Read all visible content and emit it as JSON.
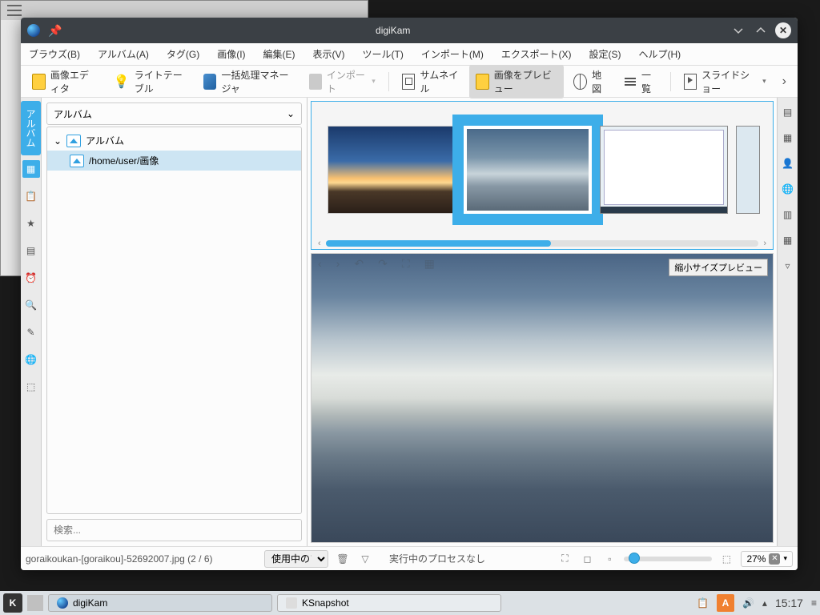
{
  "window": {
    "title": "digiKam"
  },
  "menu": {
    "browse": "ブラウズ(B)",
    "album": "アルバム(A)",
    "tag": "タグ(G)",
    "image": "画像(I)",
    "edit": "編集(E)",
    "view": "表示(V)",
    "tool": "ツール(T)",
    "import": "インポート(M)",
    "export": "エクスポート(X)",
    "settings": "設定(S)",
    "help": "ヘルプ(H)"
  },
  "toolbar": {
    "editor": "画像エディタ",
    "lighttable": "ライトテーブル",
    "batch": "一括処理マネージャ",
    "import": "インポート",
    "thumbnail": "サムネイル",
    "preview": "画像をプレビュー",
    "map": "地図",
    "list": "一覧",
    "slideshow": "スライドショー"
  },
  "sidebar": {
    "tab_label": "アルバム",
    "header": "アルバム",
    "root": "アルバム",
    "path": "/home/user/画像",
    "search_placeholder": "検索..."
  },
  "preview": {
    "badge": "縮小サイズプレビュー"
  },
  "status": {
    "filename": "goraikoukan-[goraikou]-52692007.jpg (2 / 6)",
    "filter": "使用中のフィ.",
    "process": "実行中のプロセスなし",
    "zoom": "27%"
  },
  "taskbar": {
    "app1": "digiKam",
    "app2": "KSnapshot",
    "time": "15:17"
  }
}
